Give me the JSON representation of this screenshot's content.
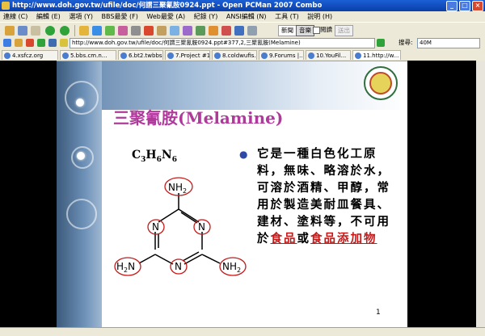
{
  "window": {
    "title": "http://www.doh.gov.tw/ufile/doc/何謂三聚氰胺0924.ppt - Open PCMan 2007 Combo"
  },
  "menu": [
    "連線 (C)",
    "編輯 (E)",
    "選項 (Y)",
    "BBS最愛 (F)",
    "Web最愛 (A)",
    "紀錄 (Y)",
    "ANSI編輯 (N)",
    "工具 (T)",
    "說明 (H)"
  ],
  "toolbar": {
    "btn1": "新聞",
    "btn2": "音樂",
    "btn3": "閱讀",
    "btn4": "送出"
  },
  "address": {
    "url": "http://www.doh.gov.tw/ufile/doc/何謂三聚氰胺0924.ppt#377,2,三聚氰胺(Melamine)"
  },
  "search": {
    "label": "搜尋:",
    "value": "40M"
  },
  "tabs": [
    "4.xsfcz.org",
    "5.bbs.cm.n...",
    "6.bt2.twbbs...",
    "7.Project #1 |",
    "8.coldwufis...",
    "9.Forums |...",
    "10.YouFil...",
    "11.http://w..."
  ],
  "slide": {
    "title": "三聚氰胺(Melamine)",
    "formula": {
      "c": "C",
      "c_n": "3",
      "h": "H",
      "h_n": "6",
      "n": "N",
      "n_n": "6"
    },
    "body_1": "它是一種白色化工原料，無味、略溶於水，可溶於酒精、甲醇，常用於製造美耐皿餐具、建材、塗料等，不可用於",
    "body_red_1": "食品",
    "body_2": "或",
    "body_red_2": "食品添加物",
    "page_number": "1",
    "atoms": {
      "nh2_top": "NH",
      "nh2_left": "H",
      "nh2_right": "NH",
      "sub2": "2",
      "n": "N"
    }
  },
  "colors": {
    "title": "#b03a9c",
    "highlight": "#c41a1a",
    "titlebar": "#0a3fa8"
  }
}
